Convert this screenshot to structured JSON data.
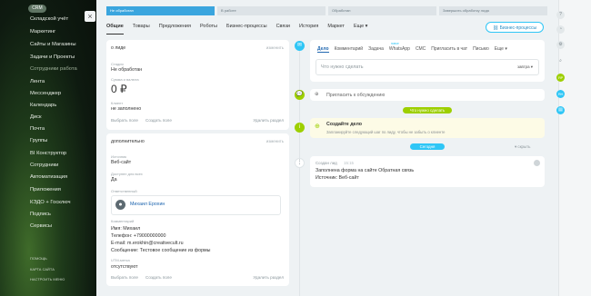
{
  "sidebar": {
    "crm_badge": "CRM",
    "close_icon": "×",
    "items": [
      "Складской учёт",
      "Маркетинг",
      "Сайты и Магазины",
      "Задачи и Проекты",
      "Сотрудники",
      "Лента",
      "Мессенджер",
      "Календарь",
      "Диск",
      "Почта",
      "Группы",
      "BI Конструктор",
      "Сотрудники",
      "Автоматизация",
      "Приложения",
      "КЭДО + Госключ",
      "Подпись",
      "Сервисы"
    ],
    "grouping_label": "Сотрудники работа",
    "bottom_links": [
      "ПОМОЩЬ",
      "КАРТА САЙТА",
      "НАСТРОИТЬ МЕНЮ"
    ]
  },
  "stages": [
    "Не обработан",
    "В работе",
    "Обработан",
    "Завершить обработку лида"
  ],
  "tabs": [
    "Общие",
    "Товары",
    "Предложения",
    "Роботы",
    "Бизнес-процессы",
    "Связи",
    "История",
    "Маркет",
    "Еще"
  ],
  "biz_button": "Бизнес-процессы",
  "about_card": {
    "title": "о лиде",
    "action": "изменить",
    "status_label": "Стадия",
    "status_value": "Не обработан",
    "amount_label": "Сумма и валюта",
    "amount_value": "0 ₽",
    "client_label": "Клиент",
    "client_value": "не заполнено",
    "select_field": "Выбрать поле",
    "create_field": "Создать поле",
    "delete_section": "Удалить раздел"
  },
  "more_card": {
    "title": "дополнительно",
    "action": "изменить",
    "source_label": "Источник",
    "source_value": "Веб-сайт",
    "available_label": "Доступен для всех",
    "available_value": "Да",
    "responsible_label": "Ответственный",
    "responsible_name": "Михаил Ерохин",
    "comment_label": "Комментарий",
    "comment_lines": [
      "Имя: Михаил",
      "Телефон: +79000000000",
      "E-mail: m.erokhin@creativecult.ru",
      "Сообщение: Тестовое сообщение из формы"
    ],
    "utm_label": "UTM-метка",
    "utm_value": "отсутствуют",
    "select_field": "Выбрать поле",
    "create_field": "Создать поле",
    "delete_section": "Удалить раздел"
  },
  "activity": {
    "tabs": [
      "Дело",
      "Комментарий",
      "Задача",
      "WhatsApp",
      "СМС",
      "Пригласить в чат",
      "Письмо",
      "Еще"
    ],
    "whatsapp_badge": "новое",
    "placeholder": "Что нужно сделать",
    "deadline": "завтра",
    "invite": "Пригласить к обсуждению",
    "todo_pill": "Что нужно сделать",
    "create_title": "Создайте дело",
    "create_desc": "Запланируйте следующий шаг по лиду, чтобы не забыть о клиенте",
    "today_pill": "Сегодня",
    "hide_label": "▾ скрыть",
    "event_title": "Создан лид",
    "event_time": "15:15",
    "event_line1": "Заполнена форма на сайте Обратная связь",
    "event_line2": "Источник: Веб-сайт"
  },
  "rightbar": {
    "avatar1": "ЯР",
    "avatar2": "ЯН"
  }
}
